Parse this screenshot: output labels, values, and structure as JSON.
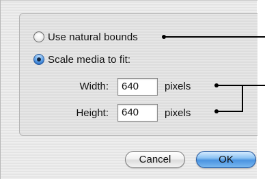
{
  "options": {
    "natural_bounds_label": "Use natural bounds",
    "natural_bounds_selected": false,
    "scale_to_fit_label": "Scale media to fit:",
    "scale_to_fit_selected": true
  },
  "dimensions": {
    "width_label": "Width:",
    "width_value": "640",
    "width_units": "pixels",
    "height_label": "Height:",
    "height_value": "640",
    "height_units": "pixels"
  },
  "buttons": {
    "cancel_label": "Cancel",
    "ok_label": "OK"
  },
  "colors": {
    "default_button": "#5ea3ea",
    "selected_radio": "#2b6fc6"
  },
  "icons": {
    "radio_off": "radio-unselected-icon",
    "radio_on": "radio-selected-icon"
  }
}
